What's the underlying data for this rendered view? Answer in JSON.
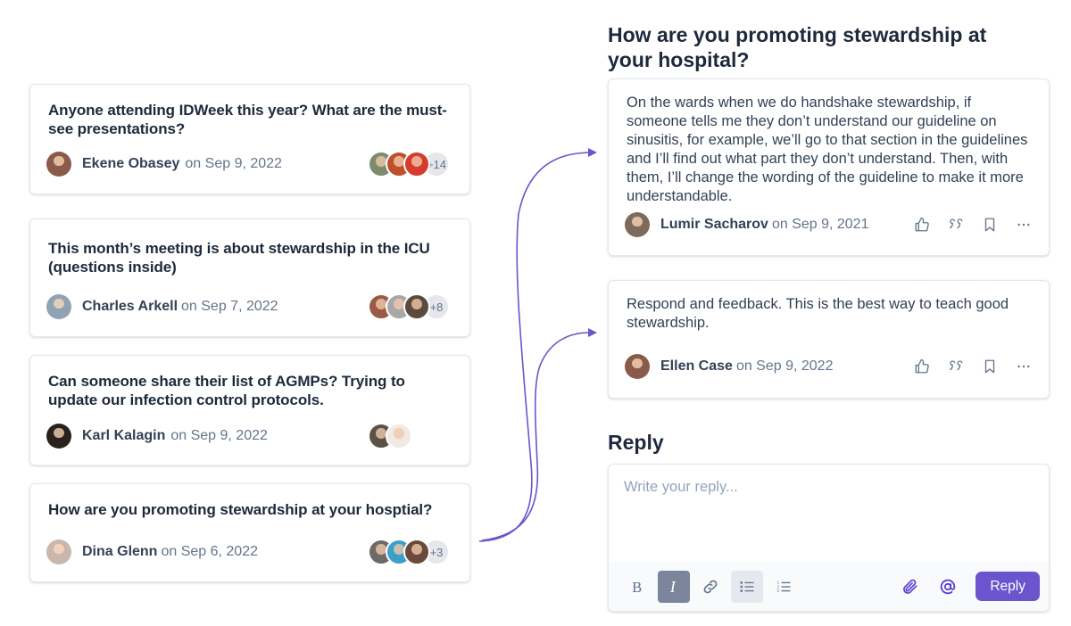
{
  "threads": [
    {
      "title": "Anyone attending IDWeek this year? What are the must-see presentations?",
      "author": "Ekene Obasey",
      "date": "on Sep 9, 2022",
      "avatar_color": "#8a5a4a",
      "participants": [
        "#7c8b6e",
        "#c0502b",
        "#d73b2e"
      ],
      "more": "+14"
    },
    {
      "title": "This month’s meeting is about stewardship in the ICU (questions inside)",
      "author": "Charles Arkell",
      "date": "on Sep 7, 2022",
      "avatar_color": "#8fa3b5",
      "participants": [
        "#9b5a45",
        "#a8a8a8",
        "#5b4a3e"
      ],
      "more": "+8"
    },
    {
      "title": "Can someone share their list of AGMPs? Trying to update our infection control protocols.",
      "author": "Karl Kalagin",
      "date": "on Sep 9, 2022",
      "avatar_color": "#2a211d",
      "participants": [
        "#5c5147",
        "#f1e9e4"
      ],
      "more": ""
    },
    {
      "title": "How are you promoting stewardship at your hosptial?",
      "author": "Dina Glenn",
      "date": "on Sep 6, 2022",
      "avatar_color": "#c9b7ac",
      "participants": [
        "#6e6a66",
        "#3aa0c9",
        "#6a4a3c"
      ],
      "more": "+3"
    }
  ],
  "detail": {
    "title": "How are you promoting stewardship at your hospital?",
    "comments": [
      {
        "body": "On the wards when we do handshake stewardship, if someone tells me they don’t understand our guideline on sinusitis, for example, we’ll go to that section in the guidelines and I’ll find out what part they don’t understand. Then, with them, I’ll change the wording of the guideline to make it more understandable.",
        "author": "Lumir Sacharov",
        "date": "on Sep 9, 2021",
        "avatar_color": "#7d6a5a"
      },
      {
        "body": "Respond and feedback. This is the best way to teach good stewardship.",
        "author": "Ellen Case",
        "date": "on Sep 9, 2022",
        "avatar_color": "#8a5a4a"
      }
    ],
    "actions": [
      "like-icon",
      "quote-icon",
      "bookmark-icon",
      "more-icon"
    ]
  },
  "reply": {
    "heading": "Reply",
    "placeholder": "Write your reply...",
    "toolbar": [
      "bold",
      "italic",
      "link",
      "bulleted-list",
      "numbered-list",
      "attach",
      "mention"
    ],
    "button_label": "Reply"
  },
  "colors": {
    "accent": "#6a55cc",
    "connector": "#6a55cc"
  }
}
